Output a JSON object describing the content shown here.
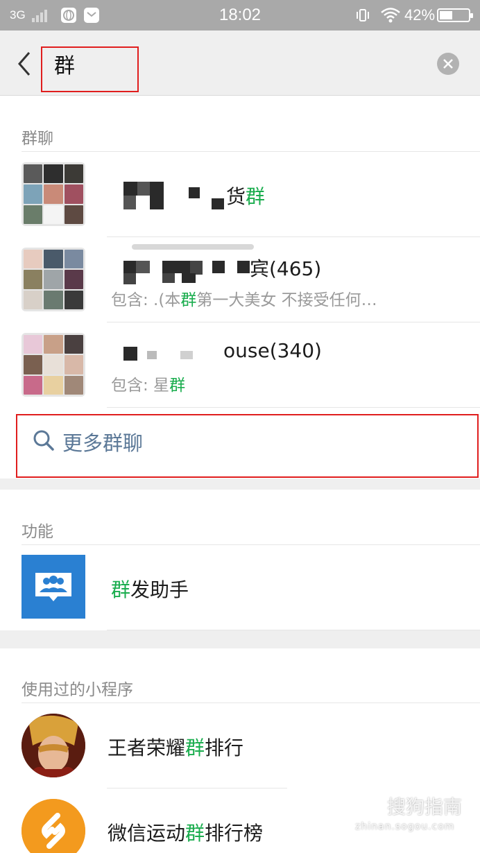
{
  "status_bar": {
    "network": "3G",
    "time": "18:02",
    "battery": "42%"
  },
  "search": {
    "value": "群"
  },
  "sections": {
    "group_chats_title": "群聊",
    "functions_title": "功能",
    "mini_programs_title": "使用过的小程序"
  },
  "group_chats": [
    {
      "title_visible_suffix": "货",
      "title_highlight": "群"
    },
    {
      "title_visible_suffix": "宾(465)",
      "sub_prefix": "包含: .(本",
      "sub_highlight": "群",
      "sub_suffix": "第一大美女 不接受任何…"
    },
    {
      "title_visible_suffix": "ouse(340)",
      "sub_prefix": "包含: 星",
      "sub_highlight": "群"
    }
  ],
  "more_group_chats": "更多群聊",
  "functions": [
    {
      "highlight": "群",
      "rest": "发助手"
    }
  ],
  "mini_programs": [
    {
      "prefix": "王者荣耀",
      "highlight": "群",
      "suffix": "排行"
    },
    {
      "prefix": "微信运动",
      "highlight": "群",
      "suffix": "排行榜"
    }
  ],
  "watermark": {
    "text": "搜狗指南",
    "url": "zhinan.sogou.com"
  },
  "colors": {
    "highlight_green": "#1aad4e",
    "link_blue": "#5b7897",
    "annotation_red": "#e01d1d",
    "function_icon_blue": "#2a80d2"
  }
}
